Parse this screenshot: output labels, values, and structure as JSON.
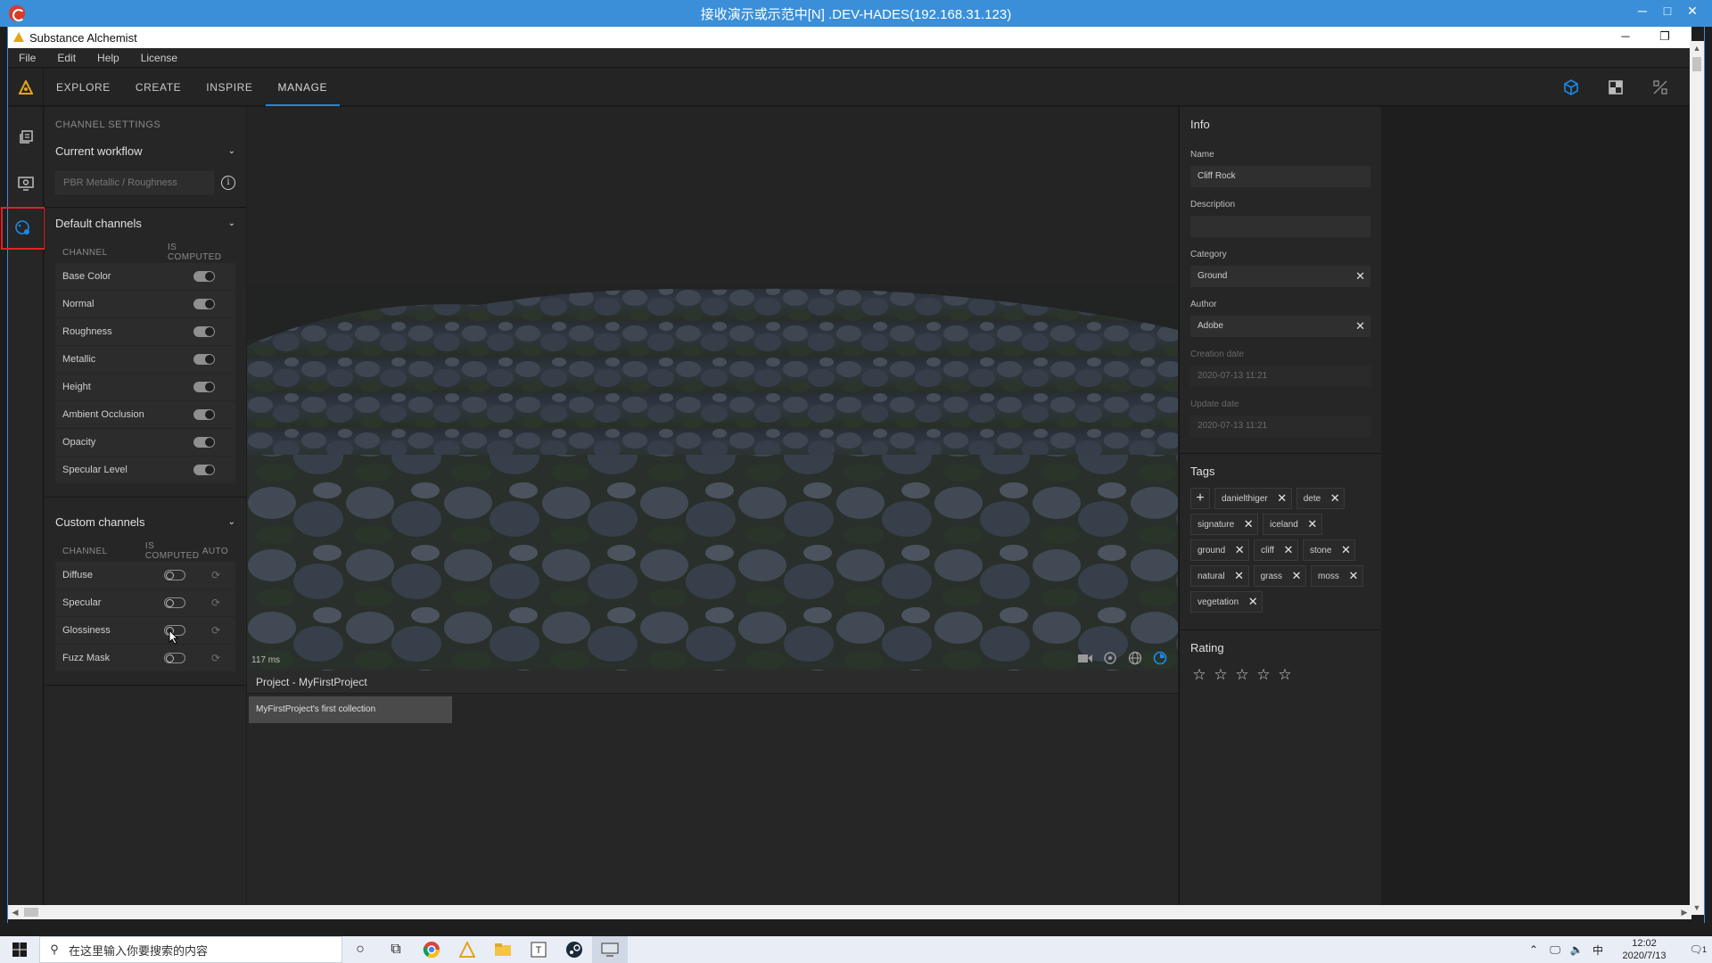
{
  "rdp": {
    "title": "接收演示或示范中[N] .DEV-HADES(192.168.31.123)",
    "min": "─",
    "max": "□",
    "close": "✕"
  },
  "app": {
    "title": "Substance Alchemist"
  },
  "menu": [
    "File",
    "Edit",
    "Help",
    "License"
  ],
  "nav": {
    "tabs": [
      "EXPLORE",
      "CREATE",
      "INSPIRE",
      "MANAGE"
    ],
    "active": "MANAGE"
  },
  "left": {
    "section_title": "CHANNEL SETTINGS",
    "workflow": {
      "label": "Current workflow",
      "placeholder": "PBR Metallic / Roughness"
    },
    "default_channels": {
      "label": "Default channels",
      "col_channel": "CHANNEL",
      "col_computed": "IS COMPUTED",
      "rows": [
        {
          "name": "Base Color",
          "computed": true
        },
        {
          "name": "Normal",
          "computed": true
        },
        {
          "name": "Roughness",
          "computed": true
        },
        {
          "name": "Metallic",
          "computed": true
        },
        {
          "name": "Height",
          "computed": true
        },
        {
          "name": "Ambient Occlusion",
          "computed": true
        },
        {
          "name": "Opacity",
          "computed": true
        },
        {
          "name": "Specular Level",
          "computed": true
        }
      ]
    },
    "custom_channels": {
      "label": "Custom channels",
      "col_channel": "CHANNEL",
      "col_computed": "IS COMPUTED",
      "col_auto": "AUTO",
      "rows": [
        {
          "name": "Diffuse",
          "computed": false
        },
        {
          "name": "Specular",
          "computed": false
        },
        {
          "name": "Glossiness",
          "computed": false
        },
        {
          "name": "Fuzz Mask",
          "computed": false
        }
      ]
    }
  },
  "viewport": {
    "render_time": "117 ms"
  },
  "project": {
    "title": "Project - MyFirstProject",
    "collection": "MyFirstProject's first collection"
  },
  "info": {
    "title": "Info",
    "name_label": "Name",
    "name_value": "Cliff Rock",
    "description_label": "Description",
    "description_value": "",
    "category_label": "Category",
    "category_value": "Ground",
    "author_label": "Author",
    "author_value": "Adobe",
    "creation_label": "Creation date",
    "creation_value": "2020-07-13 11:21",
    "update_label": "Update date",
    "update_value": "2020-07-13 11:21",
    "tags_label": "Tags",
    "tags": [
      "danielthiger",
      "dete",
      "signature",
      "iceland",
      "ground",
      "cliff",
      "stone",
      "natural",
      "grass",
      "moss",
      "vegetation"
    ],
    "rating_label": "Rating",
    "rating_value": 0,
    "rating_max": 5
  },
  "taskbar": {
    "search_placeholder": "在这里输入你要搜索的内容",
    "time": "12:02",
    "date": "2020/7/13",
    "ime": "中",
    "notifications": "1"
  },
  "colors": {
    "accent": "#1c8ae6",
    "highlight": "#e32222",
    "rdp_bar": "#3a8fd8"
  }
}
